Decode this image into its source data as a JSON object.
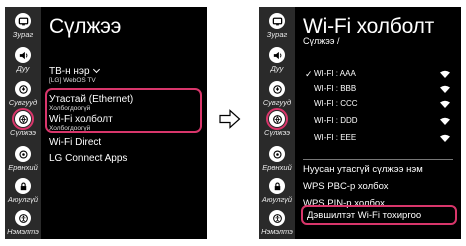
{
  "left_panel": {
    "title": "Сүлжээ",
    "menu": [
      {
        "label": "ТВ-н нэр",
        "sub": "[LG] WebOS TV"
      },
      {
        "label": "Утастай (Ethernet)",
        "sub": "Холбогдоогүй"
      },
      {
        "label": "Wi-Fi холболт",
        "sub": "Холбогдоогүй"
      },
      {
        "label": "Wi-Fi Direct"
      },
      {
        "label": "LG Connect Apps"
      }
    ]
  },
  "right_panel": {
    "title": "Wi-Fi холболт",
    "breadcrumb": "Сүлжээ /",
    "networks": [
      {
        "name": "WI-FI : AAA",
        "connected": true
      },
      {
        "name": "WI-FI : BBB",
        "connected": false
      },
      {
        "name": "WI-FI : CCC",
        "connected": false
      },
      {
        "name": "WI-FI : DDD",
        "connected": false
      },
      {
        "name": "WI-FI : EEE",
        "connected": false
      }
    ],
    "options": [
      {
        "label": "Нуусан утасгүй сүлжээ нэм"
      },
      {
        "label": "WPS PBC-р холбох"
      },
      {
        "label": "WPS PIN-р холбох"
      },
      {
        "label": "Дэвшилтэт Wi-Fi тохиргоо"
      }
    ]
  },
  "sidebar": {
    "items": [
      {
        "label": "Зураг",
        "icon": "picture-icon"
      },
      {
        "label": "Дуу",
        "icon": "sound-icon"
      },
      {
        "label": "Сувгууд",
        "icon": "channels-icon"
      },
      {
        "label": "Сүлжээ",
        "icon": "network-icon",
        "active": true
      },
      {
        "label": "Ерөнхий",
        "icon": "general-icon"
      },
      {
        "label": "Аюулгүй",
        "icon": "lock-icon"
      },
      {
        "label": "Нэмэлтэ",
        "icon": "accessibility-icon"
      }
    ]
  },
  "colors": {
    "highlight": "#d9366b",
    "panel_bg": "#000000",
    "sidebar_bg": "#2a2a2a"
  }
}
